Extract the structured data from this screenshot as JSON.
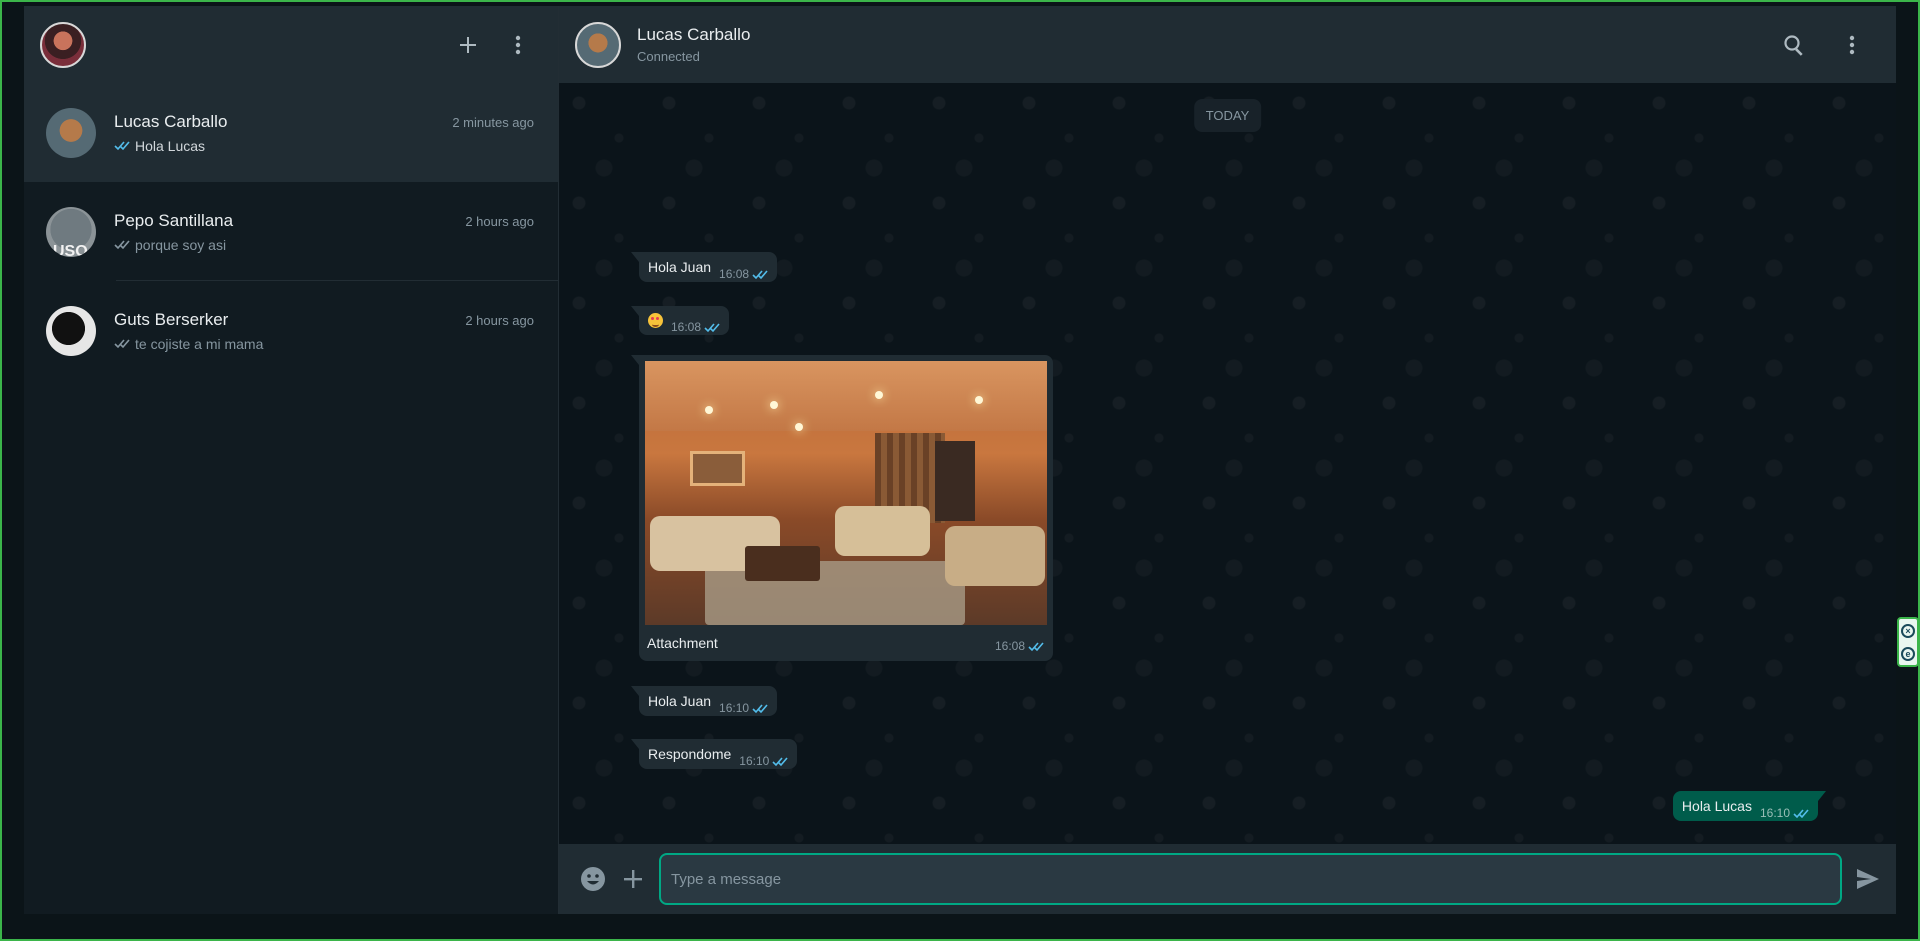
{
  "sidebar": {
    "chats": [
      {
        "name": "Lucas Carballo",
        "time": "2 minutes ago",
        "preview": "Hola Lucas",
        "read": true
      },
      {
        "name": "Pepo Santillana",
        "time": "2 hours ago",
        "preview": "porque soy asi",
        "read": false
      },
      {
        "name": "Guts Berserker",
        "time": "2 hours ago",
        "preview": "te cojiste a mi mama",
        "read": false
      }
    ]
  },
  "conversation": {
    "contact_name": "Lucas Carballo",
    "contact_status": "Connected",
    "date_divider": "TODAY",
    "messages": [
      {
        "text": "Hola Juan",
        "time": "16:08",
        "direction": "in"
      },
      {
        "text": "",
        "emoji": "star-struck-emoji",
        "time": "16:08",
        "direction": "in"
      },
      {
        "text": "Attachment",
        "time": "16:08",
        "direction": "in",
        "type": "image"
      },
      {
        "text": "Hola Juan",
        "time": "16:10",
        "direction": "in"
      },
      {
        "text": "Respondome",
        "time": "16:10",
        "direction": "in"
      },
      {
        "text": "Hola Lucas",
        "time": "16:10",
        "direction": "out"
      }
    ]
  },
  "composer": {
    "placeholder": "Type a message"
  },
  "colors": {
    "accent": "#00a884",
    "read_tick": "#53bdeb",
    "outgoing_bubble": "#005c4b",
    "incoming_bubble": "#202c33"
  },
  "icons": [
    "plus-icon",
    "menu-dots-icon",
    "search-icon",
    "emoji-icon",
    "send-icon",
    "double-check-icon"
  ]
}
